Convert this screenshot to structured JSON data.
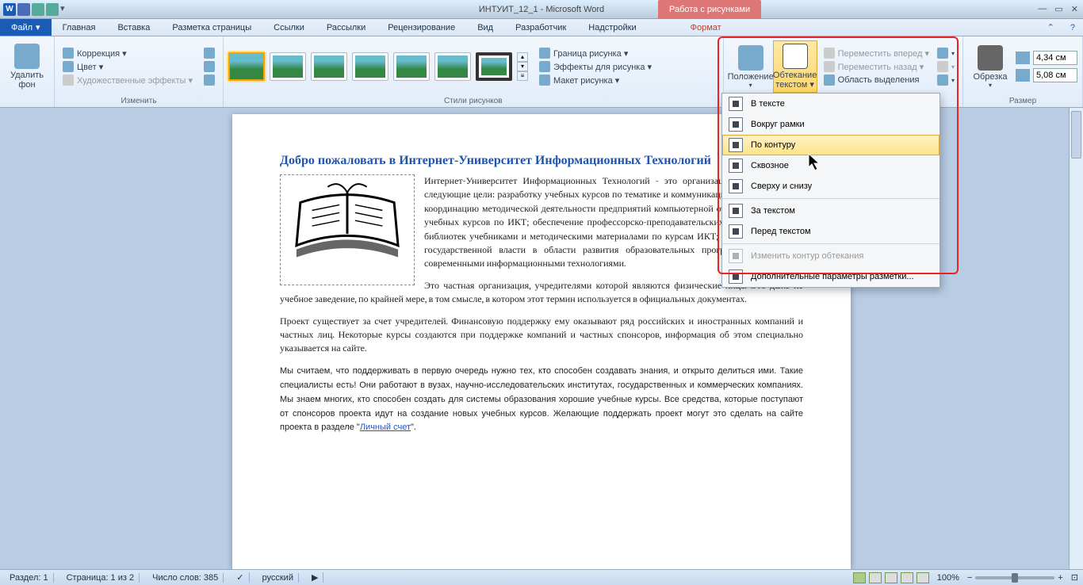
{
  "title": "ИНТУИТ_12_1 - Microsoft Word",
  "pictureToolsTitle": "Работа с рисунками",
  "fileTab": "Файл",
  "tabs": [
    "Главная",
    "Вставка",
    "Разметка страницы",
    "Ссылки",
    "Рассылки",
    "Рецензирование",
    "Вид",
    "Разработчик",
    "Надстройки"
  ],
  "formatTab": "Формат",
  "groups": {
    "removeBg": "Удалить\nфон",
    "adjust": {
      "correction": "Коррекция ▾",
      "color": "Цвет ▾",
      "artistic": "Художественные эффекты ▾",
      "label": "Изменить"
    },
    "styles": {
      "label": "Стили рисунков",
      "border": "Граница рисунка ▾",
      "effects": "Эффекты для рисунка ▾",
      "layout": "Макет рисунка ▾"
    },
    "arrange": {
      "position": "Положение",
      "wrap": "Обтекание текстом ▾",
      "forward": "Переместить вперед ▾",
      "backward": "Переместить назад ▾",
      "selection": "Область выделения"
    },
    "crop": "Обрезка",
    "size": {
      "label": "Размер",
      "h": "4,34 см",
      "w": "5,08 см"
    }
  },
  "wrapMenu": {
    "inline": "В тексте",
    "square": "Вокруг рамки",
    "tight": "По контуру",
    "through": "Сквозное",
    "topBottom": "Сверху и снизу",
    "behind": "За текстом",
    "front": "Перед текстом",
    "editPoints": "Изменить контур обтекания",
    "more": "Дополнительные параметры разметки..."
  },
  "doc": {
    "heading": "Добро пожаловать в Интернет-Университет Информационных Технологий",
    "p1a": "Интернет-Университет Информационных Технологий - это организация, которая ставит следующие цели: разработку учебных курсов по тематике и коммуникационных технологий; координацию методической деятельности предприятий компьютерной отрасли по созданию учебных курсов по ИКТ; обеспечение профессорско-преподавательских кадров вузов и их библиотек учебниками и методическими материалами по курсам ИКТ; содействие органам государственной власти в области развития образовательных программ, связанных с современными информационными технологиями.",
    "p2": "Это частная организация, учредителями которой являются физические лица. Это даже не учебное заведение, по крайней мере, в том смысле, в котором этот термин используется в официальных документах.",
    "p3": "Проект существует за счет учредителей. Финансовую поддержку ему оказывают ряд российских и иностранных компаний и частных лиц. Некоторые курсы создаются при поддержке компаний и частных спонсоров, информация об этом специально указывается на сайте.",
    "p4a": "Мы считаем, что поддерживать в первую очередь нужно тех, кто способен создавать знания, и открыто делиться ими. Такие специалисты есть! Они работают в вузах, научно-исследовательских институтах, государственных и коммерческих компаниях. Мы знаем многих, кто способен создать для системы образования хорошие учебные курсы. Все средства, которые поступают от спонсоров проекта идут на создание новых учебных курсов. Желающие поддержать проект могут это сделать на сайте проекта в разделе \"",
    "linkText": "Личный счет",
    "p4b": "\"."
  },
  "status": {
    "section": "Раздел: 1",
    "page": "Страница: 1 из 2",
    "words": "Число слов: 385",
    "lang": "русский",
    "zoom": "100%"
  }
}
